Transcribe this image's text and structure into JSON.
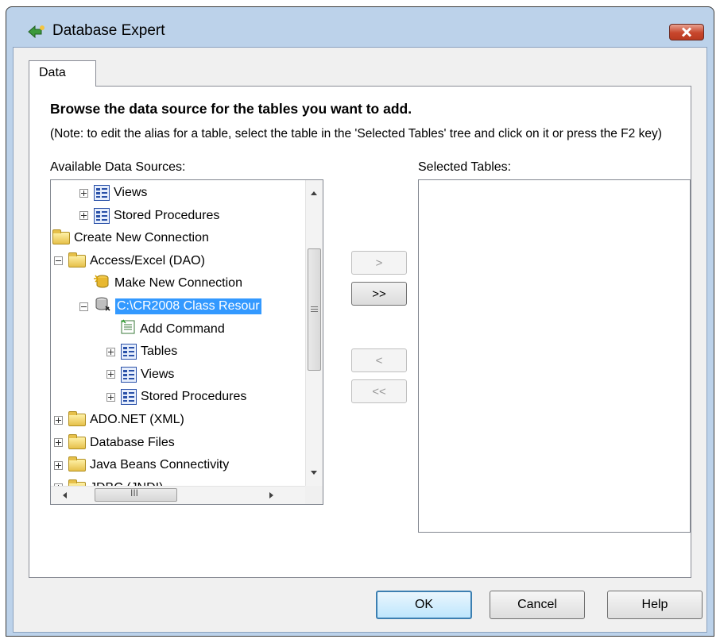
{
  "window": {
    "title": "Database Expert",
    "icon": "database-expert-icon",
    "close_icon": "close-icon"
  },
  "tabs": [
    {
      "label": "Data"
    }
  ],
  "panel": {
    "heading": "Browse the data source for the tables you want to add.",
    "note": "(Note: to edit the alias for a table, select the table in the 'Selected Tables' tree and click on it or press the F2 key)",
    "available_label": "Available Data Sources:",
    "selected_label": "Selected Tables:"
  },
  "tree": {
    "items": [
      {
        "label": "Views",
        "expander": "plus",
        "icon": "list-icon",
        "level": 2
      },
      {
        "label": "Stored Procedures",
        "expander": "plus",
        "icon": "list-icon",
        "level": 2
      },
      {
        "label": "Create New Connection",
        "expander": "none",
        "icon": "folder-icon",
        "level": 0
      },
      {
        "label": "Access/Excel (DAO)",
        "expander": "minus",
        "icon": "folder-icon",
        "level": 1
      },
      {
        "label": "Make New Connection",
        "expander": "none",
        "icon": "new-connection-icon",
        "level": 2
      },
      {
        "label": "C:\\CR2008 Class Resour",
        "expander": "minus",
        "icon": "database-icon",
        "level": 2,
        "selected": true
      },
      {
        "label": "Add Command",
        "expander": "none",
        "icon": "add-command-icon",
        "level": 3
      },
      {
        "label": "Tables",
        "expander": "plus",
        "icon": "list-icon",
        "level": 3
      },
      {
        "label": "Views",
        "expander": "plus",
        "icon": "list-icon",
        "level": 3
      },
      {
        "label": "Stored Procedures",
        "expander": "plus",
        "icon": "list-icon",
        "level": 3
      },
      {
        "label": "ADO.NET (XML)",
        "expander": "plus",
        "icon": "folder-icon",
        "level": 1
      },
      {
        "label": "Database Files",
        "expander": "plus",
        "icon": "folder-icon",
        "level": 1
      },
      {
        "label": "Java Beans Connectivity",
        "expander": "plus",
        "icon": "folder-icon",
        "level": 1
      },
      {
        "label": "JDBC (JNDI)",
        "expander": "plus",
        "icon": "folder-icon",
        "level": 1
      }
    ]
  },
  "hscroll_thumb_glyph": "III",
  "move_buttons": [
    {
      "label": ">",
      "enabled": false
    },
    {
      "label": ">>",
      "enabled": true
    },
    {
      "label": "<",
      "enabled": false
    },
    {
      "label": "<<",
      "enabled": false
    }
  ],
  "buttons": {
    "ok": "OK",
    "cancel": "Cancel",
    "help": "Help"
  },
  "colors": {
    "selection": "#3399ff",
    "frame": "#bcd2ea",
    "close_button": "#c7462c"
  }
}
